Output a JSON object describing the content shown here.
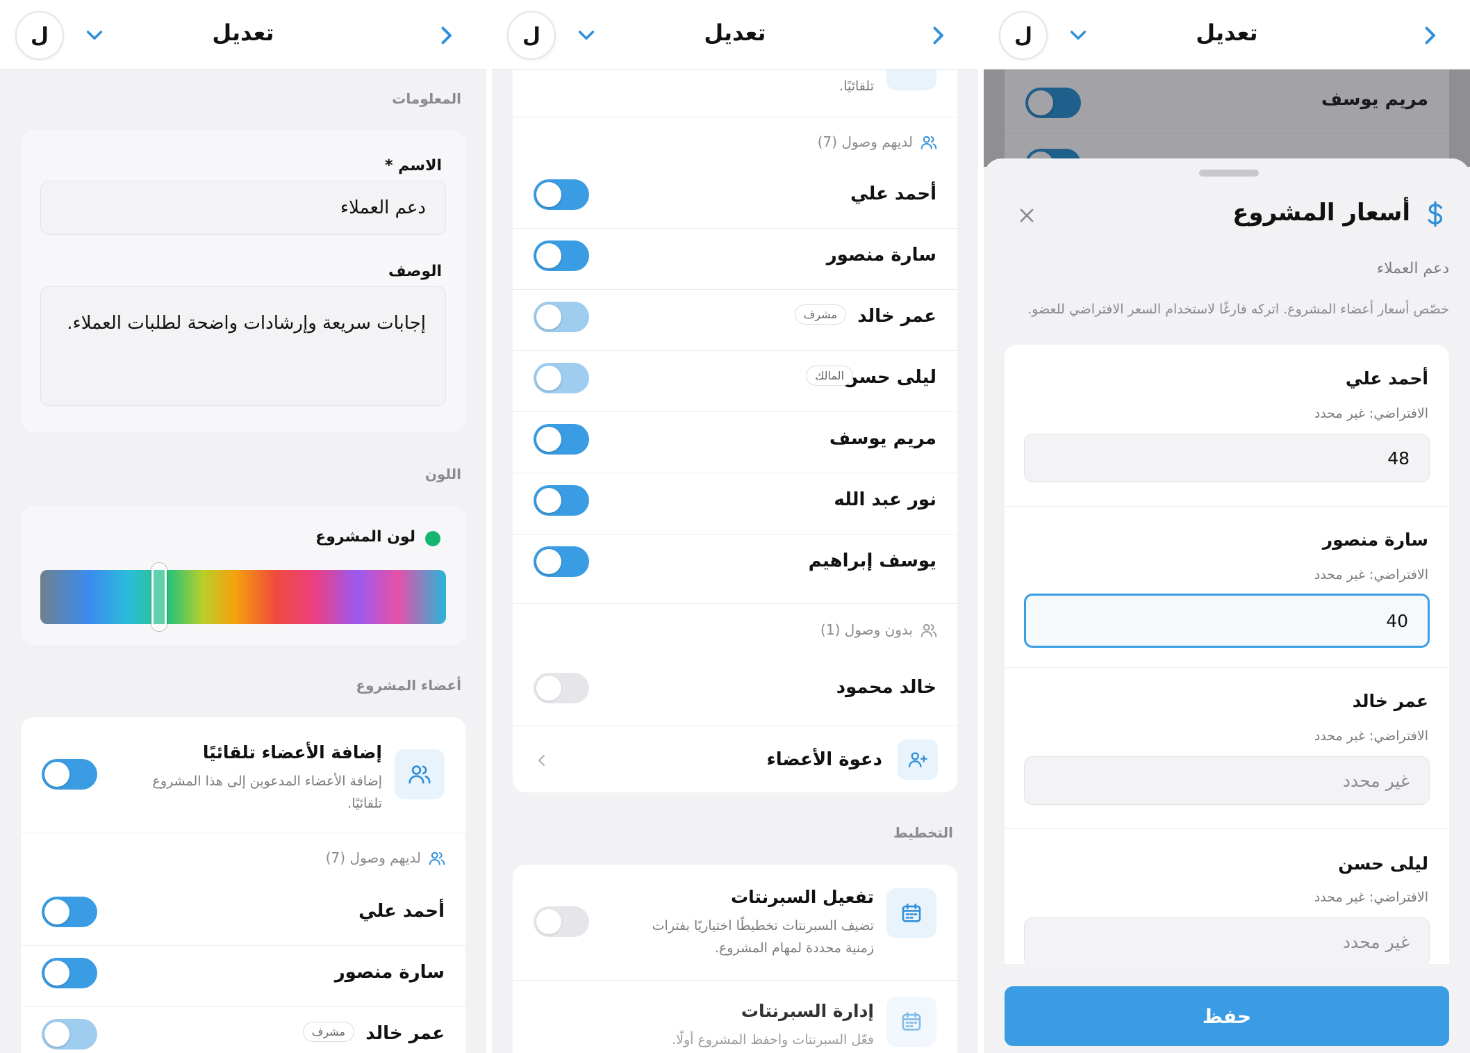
{
  "header": {
    "title": "تعديل",
    "avatar_letter": "ل"
  },
  "colors": {
    "accent": "#3a9de3",
    "project_dot": "#16b672"
  },
  "info_section": {
    "label": "المعلومات",
    "name_label": "الاسم *",
    "name_value": "دعم العملاء",
    "desc_label": "الوصف",
    "desc_value": "إجابات سريعة وإرشادات واضحة لطلبات العملاء."
  },
  "color_section": {
    "label": "اللون",
    "project_color_label": "لون المشروع"
  },
  "members_section": {
    "label": "أعضاء المشروع",
    "auto_add_title": "إضافة الأعضاء تلقائيًا",
    "auto_add_desc": "إضافة الأعضاء المدعوين إلى هذا المشروع تلقائيًا.",
    "has_access_label": "لديهم وصول (7)",
    "no_access_label": "بدون وصول (1)",
    "invite_label": "دعوة الأعضاء",
    "members_with_access": [
      {
        "name": "أحمد علي",
        "badge": "",
        "state": "on"
      },
      {
        "name": "سارة منصور",
        "badge": "",
        "state": "on"
      },
      {
        "name": "عمر خالد",
        "badge": "مشرف",
        "state": "light"
      },
      {
        "name": "ليلى حسن",
        "badge": "المالك",
        "state": "light"
      },
      {
        "name": "مريم يوسف",
        "badge": "",
        "state": "on"
      },
      {
        "name": "نور عبد الله",
        "badge": "",
        "state": "on"
      },
      {
        "name": "يوسف إبراهيم",
        "badge": "",
        "state": "on"
      }
    ],
    "members_without_access": [
      {
        "name": "خالد محمود",
        "state": "off"
      }
    ],
    "partial_desc_tail": "تلقائيًا."
  },
  "planning_section": {
    "label": "التخطيط",
    "sprints_title": "تفعيل السبرنتات",
    "sprints_desc": "تضيف السبرنتات تخطيطًا اختياريًا بفترات زمنية محددة لمهام المشروع.",
    "manage_title": "إدارة السبرنتات",
    "manage_desc": "فعّل السبرنتات واحفظ المشروع أولًا."
  },
  "pricing_sheet": {
    "background_member": "مريم يوسف",
    "title": "أسعار المشروع",
    "project_name": "دعم العملاء",
    "hint": "خصّص أسعار أعضاء المشروع. اتركه فارغًا لاستخدام السعر الافتراضي للعضو.",
    "default_text": "الافتراضي: غير محدد",
    "placeholder": "غير محدد",
    "members": [
      {
        "name": "أحمد علي",
        "value": "48"
      },
      {
        "name": "سارة منصور",
        "value": "40"
      },
      {
        "name": "عمر خالد",
        "value": ""
      },
      {
        "name": "ليلى حسن",
        "value": ""
      }
    ],
    "save_label": "حفظ"
  }
}
